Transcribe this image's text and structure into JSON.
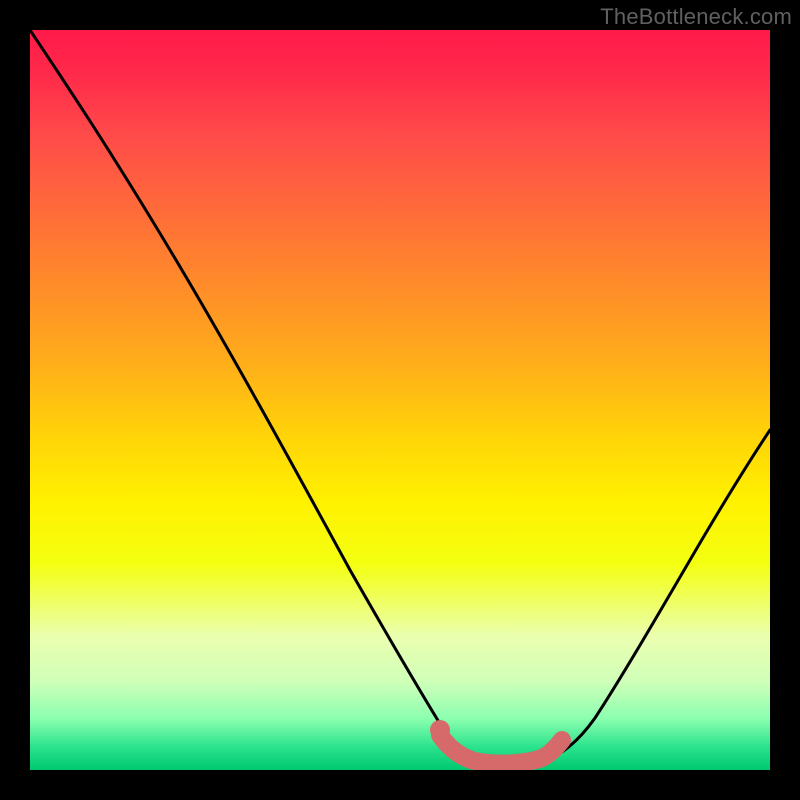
{
  "attribution": "TheBottleneck.com",
  "chart_data": {
    "type": "line",
    "title": "",
    "xlabel": "",
    "ylabel": "",
    "xlim": [
      0,
      100
    ],
    "ylim": [
      0,
      100
    ],
    "series": [
      {
        "name": "bottleneck-curve",
        "x": [
          0,
          4,
          10,
          18,
          26,
          34,
          42,
          50,
          55,
          58,
          62,
          66,
          70,
          74,
          78,
          84,
          90,
          96,
          100
        ],
        "values": [
          100,
          95,
          84,
          70,
          56,
          42,
          28,
          14,
          6,
          3,
          1,
          1,
          1,
          2,
          5,
          12,
          22,
          34,
          44
        ]
      },
      {
        "name": "highlight-segment",
        "x": [
          55,
          58,
          62,
          66,
          70
        ],
        "values": [
          4,
          2,
          1,
          1,
          3
        ]
      }
    ],
    "gradient_stops": [
      {
        "pos": 0,
        "color": "#ff1a4a"
      },
      {
        "pos": 24,
        "color": "#ff6a3a"
      },
      {
        "pos": 55,
        "color": "#ffd408"
      },
      {
        "pos": 72,
        "color": "#f4ff10"
      },
      {
        "pos": 93,
        "color": "#8cffb0"
      },
      {
        "pos": 100,
        "color": "#00c86e"
      }
    ]
  }
}
